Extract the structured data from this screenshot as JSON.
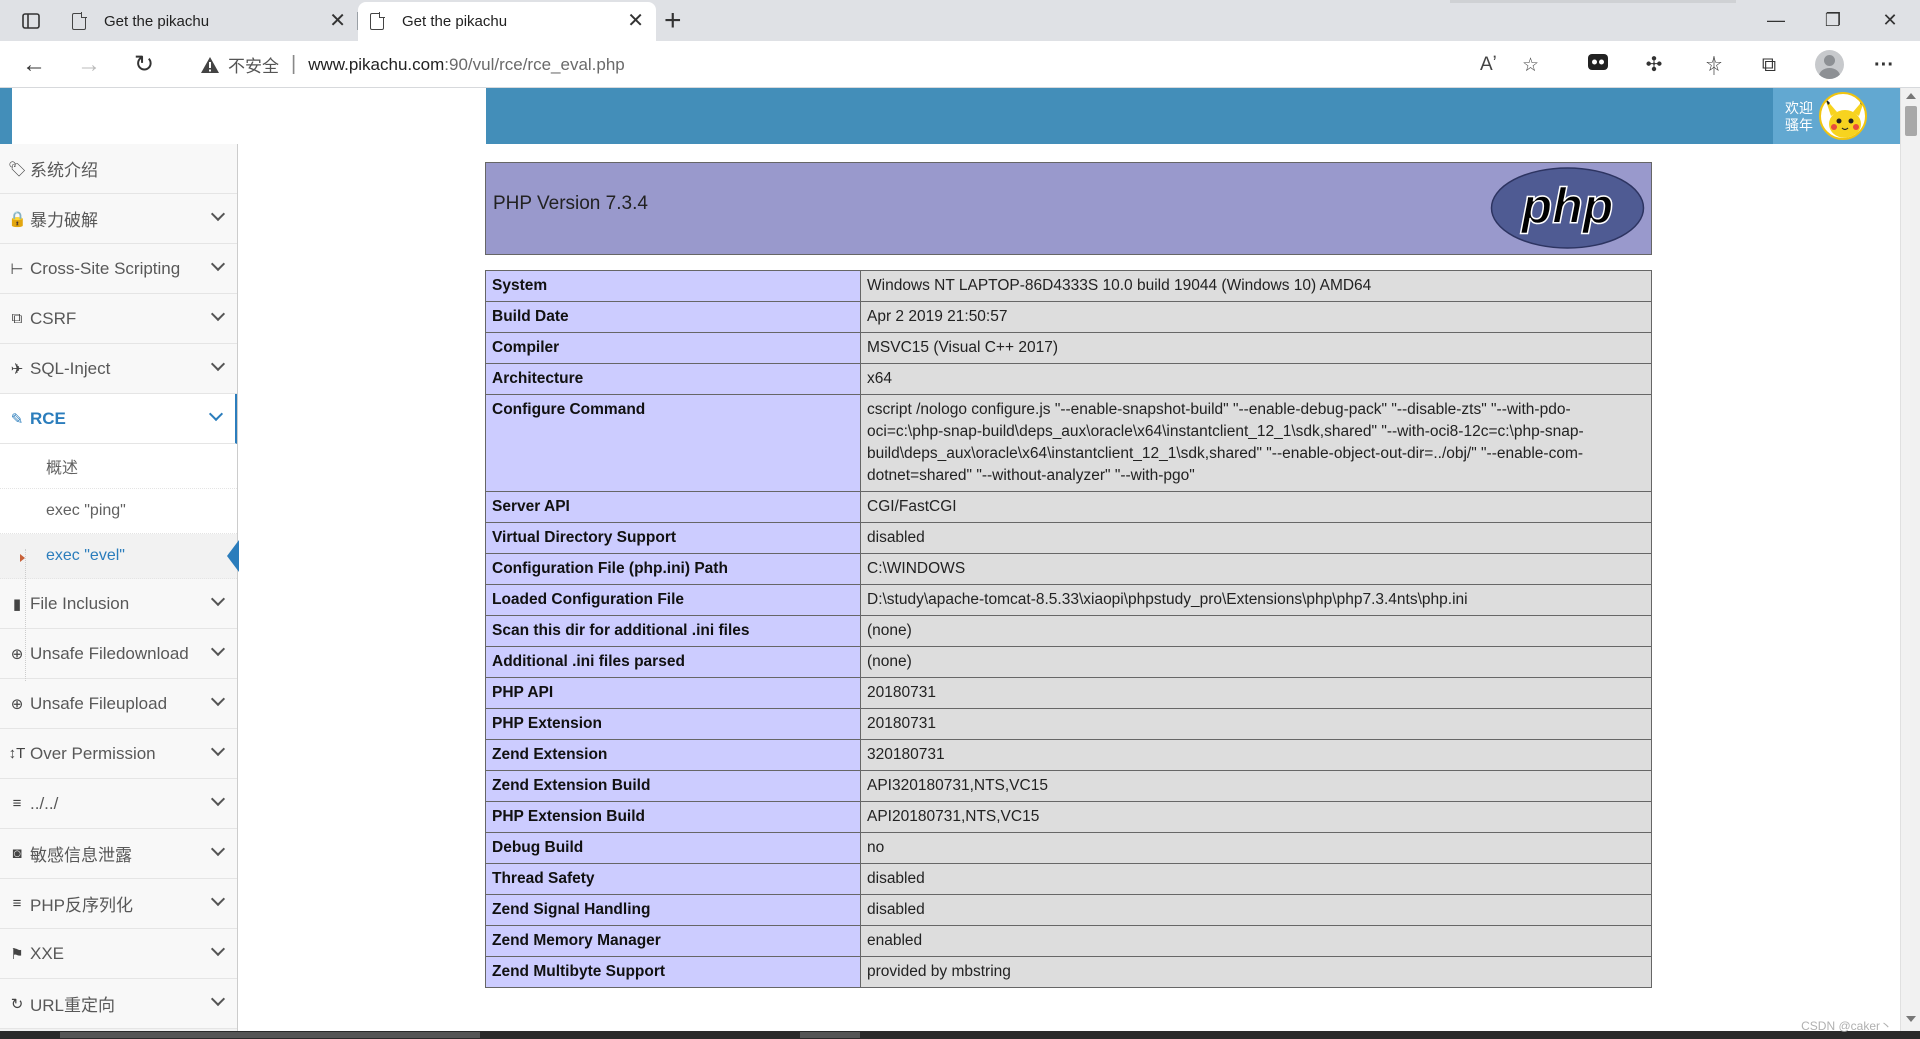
{
  "browser": {
    "tabs": [
      {
        "title": "Get the pikachu",
        "active": false
      },
      {
        "title": "Get the pikachu",
        "active": true
      }
    ],
    "security_label": "不安全",
    "url_host": "www.pikachu.com",
    "url_path": ":90/vul/rce/rce_eval.php"
  },
  "header": {
    "welcome": "欢迎骚年"
  },
  "sidebar": {
    "items": [
      {
        "label": "系统介绍",
        "icon": "tags-icon",
        "glyph": "🏷"
      },
      {
        "label": "暴力破解",
        "icon": "lock-icon",
        "glyph": "🔒"
      },
      {
        "label": "Cross-Site Scripting",
        "icon": "sitemap-icon",
        "glyph": "⊢"
      },
      {
        "label": "CSRF",
        "icon": "share-icon",
        "glyph": "⧉"
      },
      {
        "label": "SQL-Inject",
        "icon": "plane-icon",
        "glyph": "✈"
      },
      {
        "label": "RCE",
        "icon": "pencil-icon",
        "glyph": "✎"
      },
      {
        "label": "File Inclusion",
        "icon": "file-icon",
        "glyph": "▮"
      },
      {
        "label": "Unsafe Filedownload",
        "icon": "download-icon",
        "glyph": "⊕"
      },
      {
        "label": "Unsafe Fileupload",
        "icon": "upload-icon",
        "glyph": "⊕"
      },
      {
        "label": "Over Permission",
        "icon": "text-height-icon",
        "glyph": "↕T"
      },
      {
        "label": "../../",
        "icon": "list-icon",
        "glyph": "≡"
      },
      {
        "label": "敏感信息泄露",
        "icon": "camera-icon",
        "glyph": "◙"
      },
      {
        "label": "PHP反序列化",
        "icon": "list-icon",
        "glyph": "≡"
      },
      {
        "label": "XXE",
        "icon": "flag-icon",
        "glyph": "⚑"
      },
      {
        "label": "URL重定向",
        "icon": "refresh-icon",
        "glyph": "↻"
      }
    ],
    "rce_sub": [
      {
        "label": "概述"
      },
      {
        "label": "exec \"ping\""
      },
      {
        "label": "exec \"evel\""
      }
    ]
  },
  "phpinfo": {
    "version": "PHP Version 7.3.4",
    "logo_text": "php",
    "rows": [
      {
        "k": "System",
        "v": "Windows NT LAPTOP-86D4333S 10.0 build 19044 (Windows 10) AMD64"
      },
      {
        "k": "Build Date",
        "v": "Apr 2 2019 21:50:57"
      },
      {
        "k": "Compiler",
        "v": "MSVC15 (Visual C++ 2017)"
      },
      {
        "k": "Architecture",
        "v": "x64"
      },
      {
        "k": "Configure Command",
        "v": "cscript /nologo configure.js \"--enable-snapshot-build\" \"--enable-debug-pack\" \"--disable-zts\" \"--with-pdo-oci=c:\\php-snap-build\\deps_aux\\oracle\\x64\\instantclient_12_1\\sdk,shared\" \"--with-oci8-12c=c:\\php-snap-build\\deps_aux\\oracle\\x64\\instantclient_12_1\\sdk,shared\" \"--enable-object-out-dir=../obj/\" \"--enable-com-dotnet=shared\" \"--without-analyzer\" \"--with-pgo\""
      },
      {
        "k": "Server API",
        "v": "CGI/FastCGI"
      },
      {
        "k": "Virtual Directory Support",
        "v": "disabled"
      },
      {
        "k": "Configuration File (php.ini) Path",
        "v": "C:\\WINDOWS"
      },
      {
        "k": "Loaded Configuration File",
        "v": "D:\\study\\apache-tomcat-8.5.33\\xiaopi\\phpstudy_pro\\Extensions\\php\\php7.3.4nts\\php.ini"
      },
      {
        "k": "Scan this dir for additional .ini files",
        "v": "(none)"
      },
      {
        "k": "Additional .ini files parsed",
        "v": "(none)"
      },
      {
        "k": "PHP API",
        "v": "20180731"
      },
      {
        "k": "PHP Extension",
        "v": "20180731"
      },
      {
        "k": "Zend Extension",
        "v": "320180731"
      },
      {
        "k": "Zend Extension Build",
        "v": "API320180731,NTS,VC15"
      },
      {
        "k": "PHP Extension Build",
        "v": "API20180731,NTS,VC15"
      },
      {
        "k": "Debug Build",
        "v": "no"
      },
      {
        "k": "Thread Safety",
        "v": "disabled"
      },
      {
        "k": "Zend Signal Handling",
        "v": "disabled"
      },
      {
        "k": "Zend Memory Manager",
        "v": "enabled"
      },
      {
        "k": "Zend Multibyte Support",
        "v": "provided by mbstring"
      }
    ]
  },
  "watermark": "CSDN @caker丶",
  "colors": {
    "navbar": "#438eb9",
    "accent": "#2b7dbc",
    "php_header": "#9999cc",
    "php_key": "#ccccff",
    "php_value": "#dddddd"
  }
}
